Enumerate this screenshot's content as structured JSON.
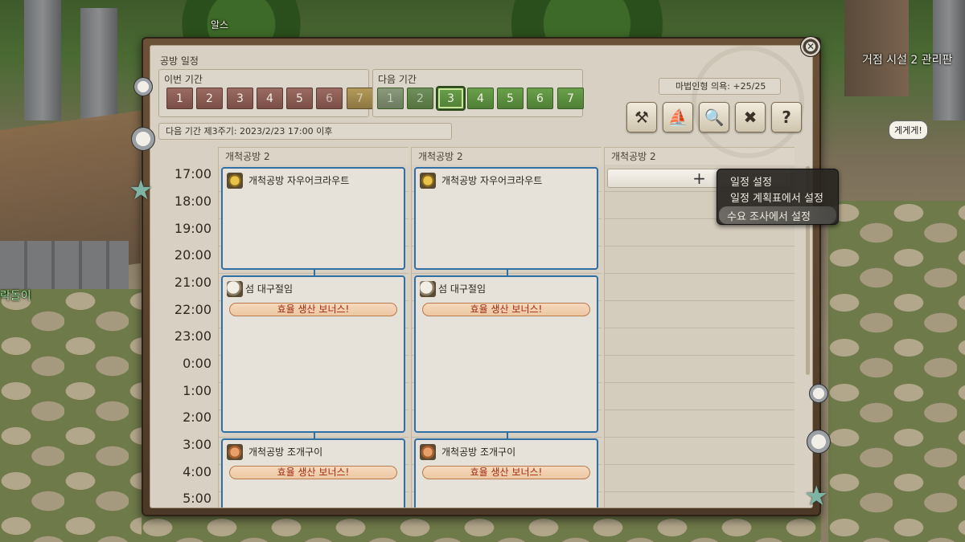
{
  "scene": {
    "hud_top_left": "알스",
    "hud_right": "거점 시설 2 관리판",
    "hud_left": "락돌이",
    "speech_bubble": "게게게!"
  },
  "window": {
    "title": "공방 일정",
    "close_icon": "close-icon"
  },
  "current_period": {
    "label": "이번 기간",
    "numbers": [
      "1",
      "2",
      "3",
      "4",
      "5",
      "6",
      "7"
    ]
  },
  "next_period": {
    "label": "다음 기간",
    "numbers": [
      "1",
      "2",
      "3",
      "4",
      "5",
      "6",
      "7"
    ],
    "selected": "3"
  },
  "next_period_info": "다음 기간 제3주기: 2023/2/23 17:00 이후",
  "magic_doll": "마법인형 의욕: +25/25",
  "toolbar": [
    {
      "name": "workshop-icon"
    },
    {
      "name": "voyage-icon"
    },
    {
      "name": "demand-search-icon"
    },
    {
      "name": "clear-icon"
    },
    {
      "name": "help-icon",
      "glyph": "?"
    }
  ],
  "times": [
    "17:00",
    "18:00",
    "19:00",
    "20:00",
    "21:00",
    "22:00",
    "23:00",
    "0:00",
    "1:00",
    "2:00",
    "3:00",
    "4:00",
    "5:00"
  ],
  "columns": [
    {
      "header": "개척공방 2",
      "tasks": [
        {
          "title": "개척공방 자우어크라우트",
          "icon": "gold-coin-icon",
          "bonus": ""
        },
        {
          "title": "섬 대구절임",
          "icon": "cloud-icon",
          "bonus": "효율 생산 보너스!"
        },
        {
          "title": "개척공방 조개구이",
          "icon": "shell-icon",
          "bonus": "효율 생산 보너스!"
        }
      ]
    },
    {
      "header": "개척공방 2",
      "tasks": [
        {
          "title": "개척공방 자우어크라우트",
          "icon": "gold-coin-icon",
          "bonus": ""
        },
        {
          "title": "섬 대구절임",
          "icon": "cloud-icon",
          "bonus": "효율 생산 보너스!"
        },
        {
          "title": "개척공방 조개구이",
          "icon": "shell-icon",
          "bonus": "효율 생산 보너스!"
        }
      ]
    },
    {
      "header": "개척공방 2",
      "add_label": "+"
    }
  ],
  "context_menu": {
    "items": [
      "일정 설정",
      "일정 계획표에서 설정",
      "수요 조사에서 설정"
    ],
    "highlighted": "수요 조사에서 설정"
  }
}
